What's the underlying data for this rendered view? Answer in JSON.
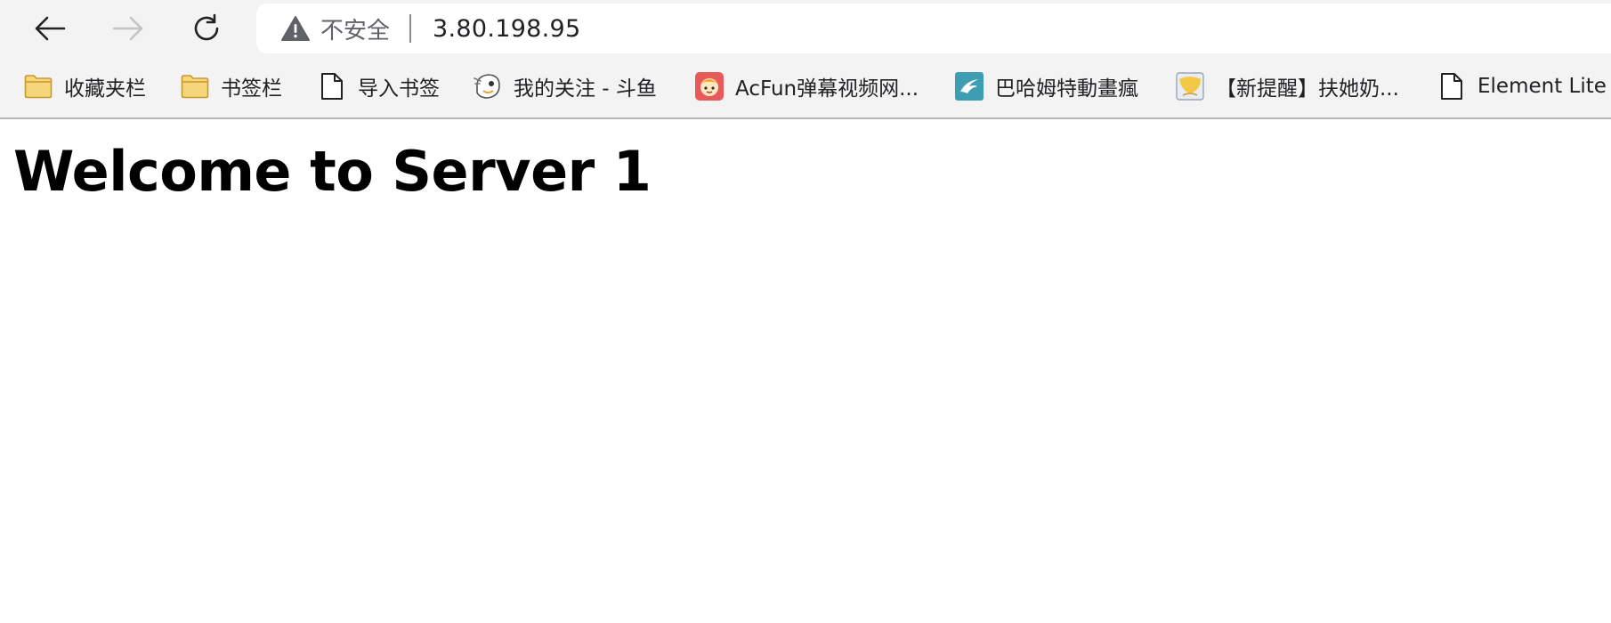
{
  "browser": {
    "nav": {
      "back_icon": "arrow-left-icon",
      "forward_icon": "arrow-right-icon",
      "reload_icon": "reload-icon",
      "forward_enabled": false
    },
    "omnibox": {
      "security_icon": "warning-triangle-icon",
      "security_label": "不安全",
      "url": "3.80.198.95"
    },
    "bookmarks": [
      {
        "label": "收藏夹栏",
        "icon": "folder-icon"
      },
      {
        "label": "书签栏",
        "icon": "folder-icon"
      },
      {
        "label": "导入书签",
        "icon": "page-icon"
      },
      {
        "label": "我的关注 - 斗鱼",
        "icon": "douyu-icon"
      },
      {
        "label": "AcFun弹幕视频网...",
        "icon": "acfun-icon"
      },
      {
        "label": "巴哈姆特動畫瘋",
        "icon": "bahamut-icon"
      },
      {
        "label": "【新提醒】扶她奶...",
        "icon": "site-favicon-icon"
      },
      {
        "label": "Element Lite",
        "icon": "page-icon"
      }
    ]
  },
  "page": {
    "heading": "Welcome to Server 1"
  },
  "colors": {
    "chrome_bg": "#f3f3f3",
    "folder_fill": "#f6d67a",
    "folder_stroke": "#c79a2b",
    "acfun_red": "#e85a5a",
    "bahamut_teal": "#3d9db3"
  }
}
